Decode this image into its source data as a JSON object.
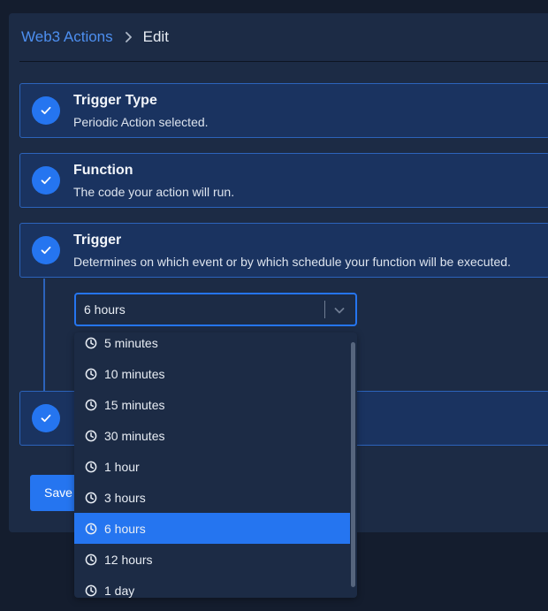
{
  "breadcrumb": {
    "parent": "Web3 Actions",
    "current": "Edit"
  },
  "steps": [
    {
      "title": "Trigger Type",
      "description": "Periodic Action selected."
    },
    {
      "title": "Function",
      "description": "The code your action will run."
    },
    {
      "title": "Trigger",
      "description": "Determines on which event or by which schedule your function will be executed."
    },
    {
      "title": "",
      "description": ""
    }
  ],
  "trigger_select": {
    "value": "6 hours",
    "options": [
      "5 minutes",
      "10 minutes",
      "15 minutes",
      "30 minutes",
      "1 hour",
      "3 hours",
      "6 hours",
      "12 hours",
      "1 day"
    ],
    "selected": "6 hours"
  },
  "save_button": {
    "label": "Save"
  },
  "colors": {
    "accent": "#2575f0",
    "panel": "#1c2b45",
    "step_background": "#1a3360",
    "link": "#4d8ff0"
  }
}
